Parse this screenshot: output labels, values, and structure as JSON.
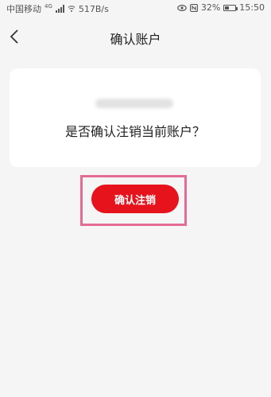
{
  "status_bar": {
    "carrier": "中国移动",
    "network": "4G",
    "speed": "517B/s",
    "battery": "32%",
    "time": "15:50",
    "icons": [
      "signal-icon",
      "wifi-icon",
      "eye-icon",
      "nfc-icon",
      "battery-icon"
    ]
  },
  "nav": {
    "title": "确认账户",
    "back_icon": "chevron-left-icon"
  },
  "card": {
    "question": "是否确认注销当前账户？"
  },
  "actions": {
    "confirm_label": "确认注销"
  },
  "colors": {
    "accent": "#e6131c",
    "highlight": "#e46b95",
    "background": "#f5f5f5"
  }
}
